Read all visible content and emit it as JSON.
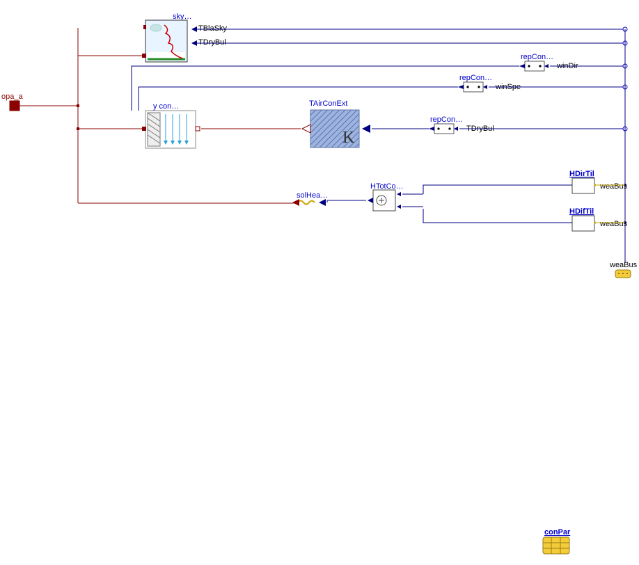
{
  "port": {
    "opa_a": "opa_a"
  },
  "blocks": {
    "sky": "sky…",
    "con": "y   con…",
    "tair": "TAirConExt",
    "kelvin": "K",
    "htot": "HTotCo…",
    "hdir": "HDirTil",
    "hdif": "HDifTil",
    "repcon": "repCon…",
    "solhea": "solHea…",
    "conpar": "conPar"
  },
  "signals": {
    "tblasky": "TBlaSky",
    "tdrybul": "TDryBul",
    "windir": "winDir",
    "winspe": "winSpe",
    "weabus": "weaBus"
  }
}
